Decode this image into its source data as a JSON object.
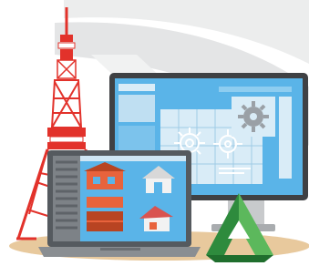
{
  "illustration": {
    "subject": "cad-workstation-with-tokyo-tower",
    "colors": {
      "tower_red": "#e2322b",
      "tower_white": "#ffffff",
      "monitor_frame": "#3f4144",
      "screen_blue": "#5ab4e8",
      "screen_panel": "#d9ecf7",
      "laptop_frame": "#555a5f",
      "ground": "#e8c99d",
      "logo_green": "#2e8b3d",
      "logo_green_light": "#5cb85c",
      "background_swoosh": "#e6e7e8"
    },
    "icons": {
      "gear": "gear-icon",
      "house": "house-icon",
      "logo": "triangle-logo-icon",
      "tower": "tokyo-tower-icon"
    }
  }
}
